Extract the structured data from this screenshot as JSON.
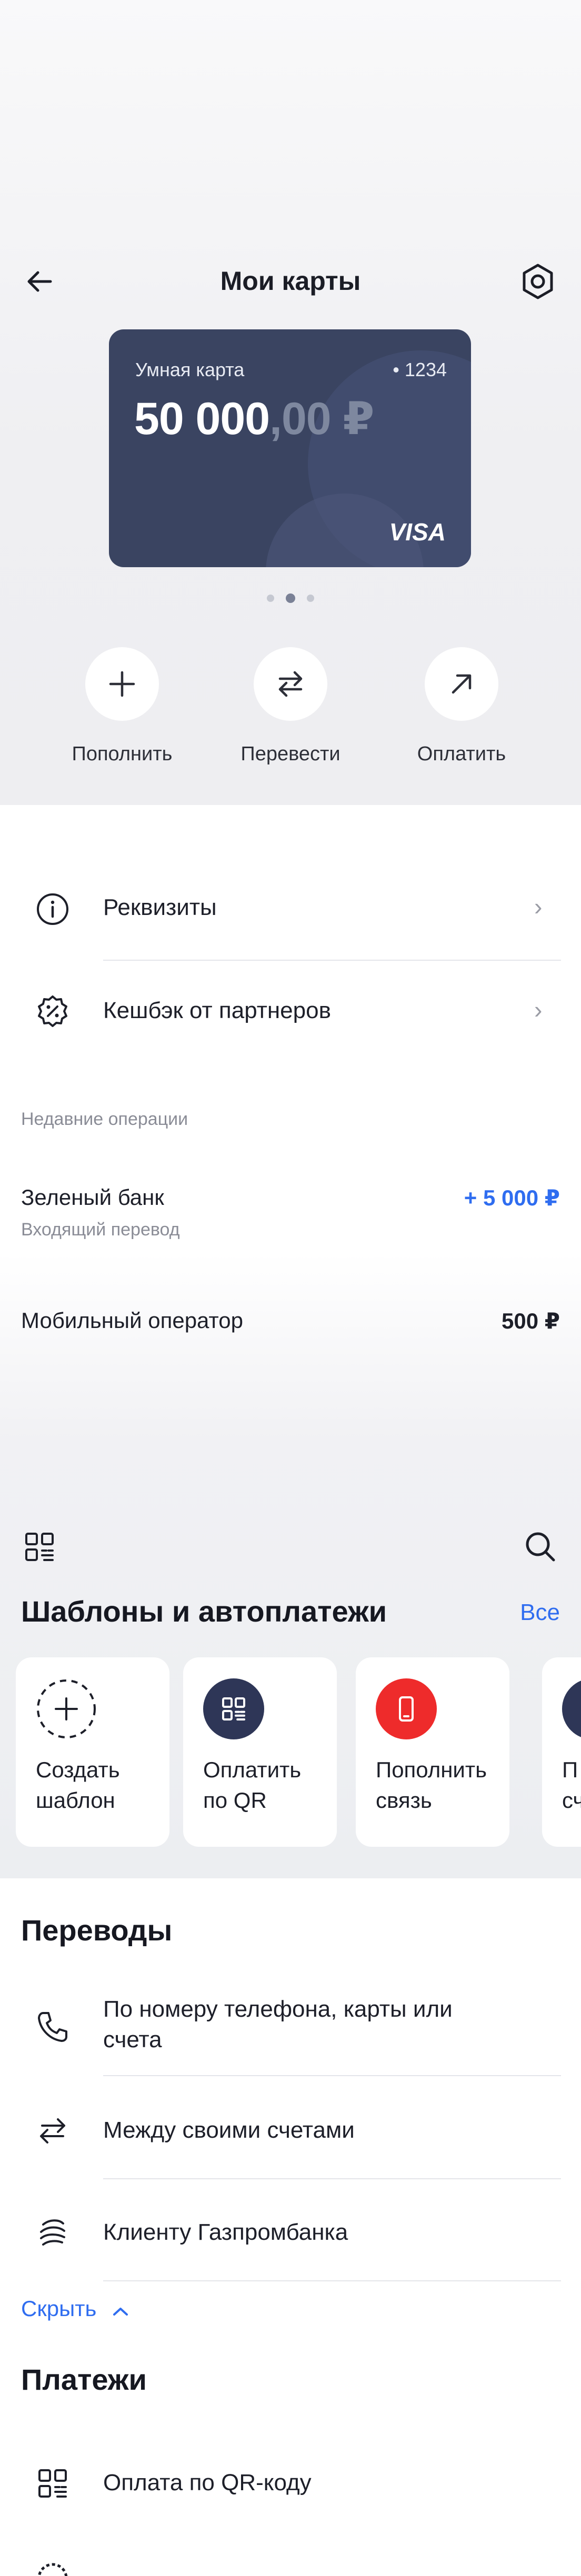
{
  "header": {
    "title": "Мои карты"
  },
  "card": {
    "name": "Умная карта",
    "number": "• 1234",
    "balance_int": "50 000",
    "balance_dec": ",00 ₽",
    "network": "VISA",
    "pages": 3,
    "active_page": 2
  },
  "actions": [
    {
      "label": "Пополнить",
      "icon": "plus-icon"
    },
    {
      "label": "Перевести",
      "icon": "transfer-icon"
    },
    {
      "label": "Оплатить",
      "icon": "arrow-up-right-icon"
    }
  ],
  "menu": [
    {
      "label": "Реквизиты",
      "icon": "info-icon"
    },
    {
      "label": "Кешбэк от партнеров",
      "icon": "percent-badge-icon"
    }
  ],
  "recent": {
    "caption": "Недавние операции",
    "items": [
      {
        "title": "Зеленый банк",
        "subtitle": "Входящий перевод",
        "amount": "+ 5 000 ₽",
        "color": "#2f6df0"
      },
      {
        "title": "Мобильный оператор",
        "subtitle": "",
        "amount": "500 ₽",
        "color": "#1d1f29"
      }
    ]
  },
  "templates": {
    "title": "Шаблоны и автоплатежи",
    "all_label": "Все",
    "tiles": [
      {
        "label": "Создать\nшаблон",
        "icon": "plus-dashed-icon"
      },
      {
        "label": "Оплатить\nпо QR",
        "icon": "qr-icon"
      },
      {
        "label": "Пополнить\nсвязь",
        "icon": "phone-icon"
      },
      {
        "label": "П\nсч",
        "icon": "partial-icon"
      }
    ]
  },
  "transfers": {
    "title": "Переводы",
    "items": [
      {
        "label": "По номеру телефона, карты или\nсчета",
        "icon": "phone-handset-icon"
      },
      {
        "label": "Между своими счетами",
        "icon": "swap-icon"
      },
      {
        "label": "Клиенту Газпромбанка",
        "icon": "gazprombank-icon"
      }
    ],
    "hide_label": "Скрыть"
  },
  "payments": {
    "title": "Платежи",
    "items": [
      {
        "label": "Оплата по QR-коду",
        "icon": "qr-icon"
      }
    ]
  },
  "colors": {
    "accent": "#2f6df0",
    "card": "#3a4461",
    "red": "#ee2b2b",
    "navy": "#2e3657"
  }
}
